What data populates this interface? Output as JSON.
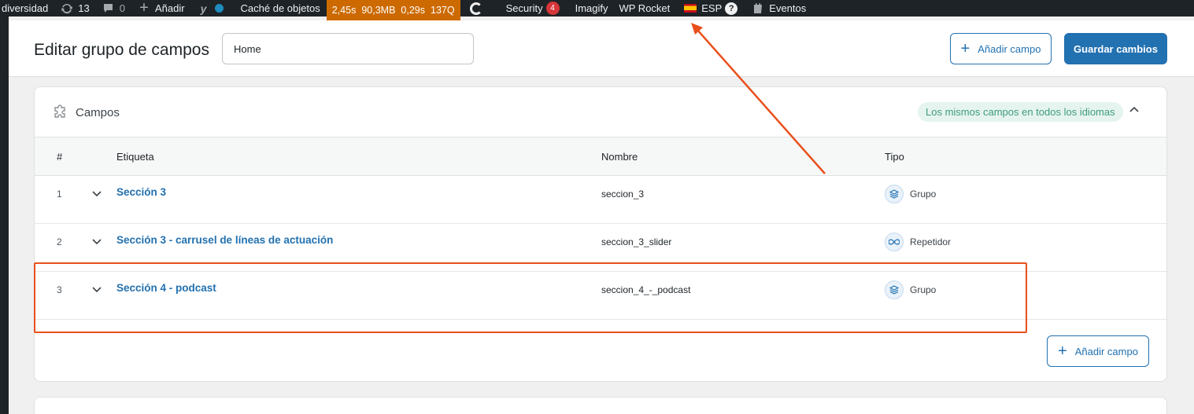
{
  "adminbar": {
    "site": "diversidad",
    "updates_count": "13",
    "comments_count": "0",
    "add_new": "Añadir",
    "object_cache": "Caché de objetos",
    "perf": [
      "2,45s",
      "90,3MB",
      "0,29s",
      "137Q"
    ],
    "security": "Security",
    "security_count": "4",
    "imagify": "Imagify",
    "wp_rocket": "WP Rocket",
    "language": "ESP",
    "help": "?",
    "events": "Eventos"
  },
  "header": {
    "title": "Editar grupo de campos",
    "group_name_value": "Home",
    "add_field_label": "Añadir campo",
    "save_label": "Guardar cambios"
  },
  "panel": {
    "title": "Campos",
    "lang_badge": "Los mismos campos en todos los idiomas",
    "columns": {
      "num": "#",
      "label": "Etiqueta",
      "name": "Nombre",
      "type": "Tipo"
    },
    "rows": [
      {
        "num": "1",
        "label": "Sección 3",
        "name": "seccion_3",
        "type": "Grupo",
        "type_icon": "layers-icon"
      },
      {
        "num": "2",
        "label": "Sección 3 - carrusel de líneas de actuación",
        "name": "seccion_3_slider",
        "type": "Repetidor",
        "type_icon": "infinity-icon"
      },
      {
        "num": "3",
        "label": "Sección 4 - podcast",
        "name": "seccion_4_-_podcast",
        "type": "Grupo",
        "type_icon": "layers-icon"
      }
    ],
    "add_field_label": "Añadir campo"
  },
  "colors": {
    "primary": "#2271b1",
    "adminbar": "#1d2327",
    "perf_bg": "#cc6a00",
    "annotation": "#e8501b",
    "badge_bg": "#e6f4ef",
    "badge_text": "#3d9b7e"
  }
}
